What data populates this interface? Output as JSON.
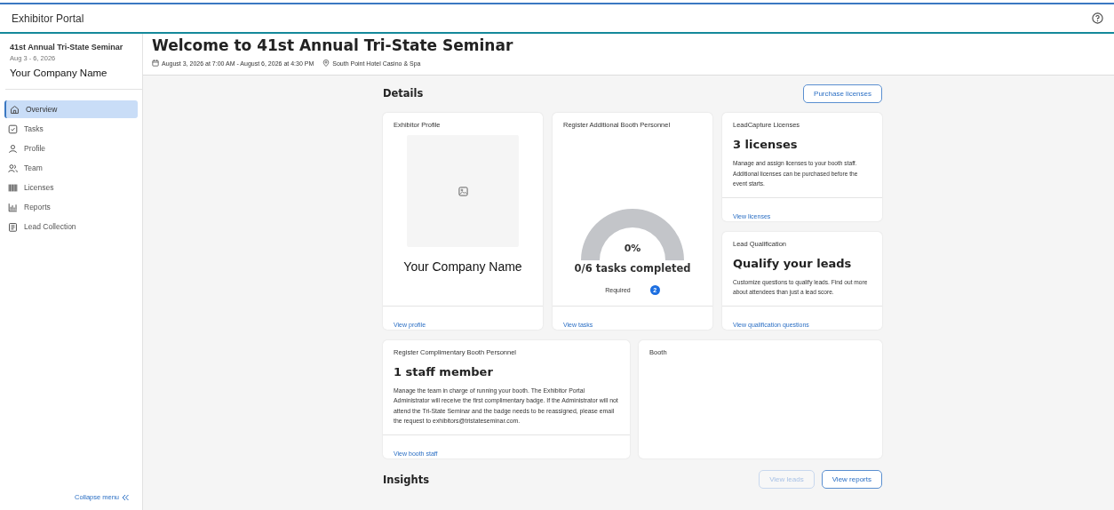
{
  "app_bar": {
    "title": "Exhibitor Portal"
  },
  "sidebar": {
    "event_name": "41st Annual Tri-State Seminar",
    "event_dates": "Aug 3 - 6, 2026",
    "company": "Your Company Name",
    "items": [
      {
        "label": "Overview",
        "selected": true
      },
      {
        "label": "Tasks",
        "selected": false
      },
      {
        "label": "Profile",
        "selected": false
      },
      {
        "label": "Team",
        "selected": false
      },
      {
        "label": "Licenses",
        "selected": false
      },
      {
        "label": "Reports",
        "selected": false
      },
      {
        "label": "Lead Collection",
        "selected": false
      }
    ],
    "collapse": "Collapse menu"
  },
  "page": {
    "title": "Welcome to 41st Annual Tri-State Seminar",
    "when": "August 3, 2026 at 7:00 AM - August 6, 2026 at 4:30 PM",
    "where": "South Point Hotel Casino & Spa"
  },
  "details": {
    "heading": "Details",
    "action": "Purchase licenses",
    "cards": [
      {
        "kind": "profile",
        "title": "Exhibitor Profile",
        "name": "Your Company Name",
        "link": "View profile"
      },
      {
        "kind": "progress",
        "title": "Register Additional Booth Personnel",
        "level": 0,
        "percent": "0%",
        "summary": "0/6 tasks completed",
        "required_label": "Required",
        "required_count": "2",
        "link": "View tasks"
      },
      {
        "kind": "info",
        "title": "LeadCapture Licenses",
        "headline": "3 licenses",
        "text": "Manage and assign licenses to your booth staff. Additional licenses can be purchased before the event starts.",
        "link": "View licenses"
      },
      {
        "kind": "info",
        "title": "Lead Qualification",
        "headline": "Qualify your leads",
        "text": "Customize questions to qualify leads. Find out more about attendees than just a lead score.",
        "link": "View qualification questions"
      },
      {
        "kind": "info",
        "title": "Register Complimentary Booth Personnel",
        "headline": "1 staff member",
        "text": "Manage the team in charge of running your booth. The Exhibitor Portal Administrator will receive the first complimentary badge. If the Administrator will not attend the Tri-State Seminar and the badge needs to be reassigned, please email the request to exhibitors@tristateseminar.com.",
        "link": "View booth staff"
      },
      {
        "kind": "empty",
        "title": "Booth"
      }
    ]
  },
  "insights": {
    "heading": "Insights",
    "buttons": [
      {
        "label": "View leads",
        "disabled": true
      },
      {
        "label": "View reports",
        "disabled": false
      }
    ]
  }
}
